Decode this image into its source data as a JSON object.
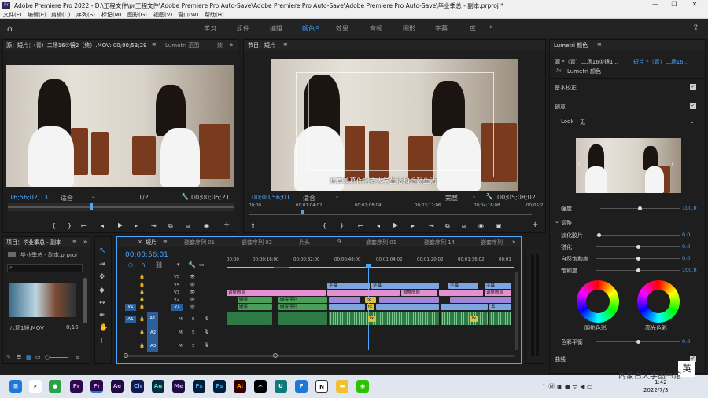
{
  "window": {
    "title": "Adobe Premiere Pro 2022 - D:\\工程文件\\pr工程文件\\Adobe Premiere Pro Auto-Save\\Adobe Premiere Pro Auto-Save\\Adobe Premiere Pro Auto-Save\\毕业季总 - 副本.prproj *",
    "minimize": "—",
    "maximize": "❐",
    "close": "✕"
  },
  "menu": [
    "文件(F)",
    "编辑(E)",
    "剪辑(C)",
    "序列(S)",
    "标记(M)",
    "图形(G)",
    "视图(V)",
    "窗口(W)",
    "帮助(H)"
  ],
  "workspaces": [
    "学习",
    "组件",
    "编辑",
    "颜色",
    "效果",
    "音频",
    "图形",
    "字幕",
    "库"
  ],
  "workspace_active": "颜色",
  "source": {
    "tab": "源：短片：(青）二场16②镜2（终）.MOV: 00;00;53;29",
    "tab2": "Lumetri 范围",
    "tab3": "效",
    "timecode": "16;56;02;13",
    "fit": "适合",
    "ratio": "1/2",
    "duration": "00;00;05;21"
  },
  "program": {
    "tab": "节目：短片",
    "timecode": "00;00;56;01",
    "fit": "适合",
    "quality": "完整",
    "duration": "00;05;08;02",
    "ruler": [
      "00;00",
      "00;01;04;02",
      "00;02;08;04",
      "00;03;12;06",
      "00;04;16;08",
      "00;05;2"
    ],
    "subtitle": "我真羡慕你啊去大学生活和后勤生活"
  },
  "project": {
    "tab": "项目：毕业季总 - 副本",
    "file": "毕业季总 - 副本.prproj",
    "item_name": "八场1镜.MOV",
    "item_duration": "8;16"
  },
  "timeline": {
    "tabs": [
      "短片",
      "嵌套序列 01",
      "嵌套序列 02",
      "片头",
      "9",
      "嵌套序列 01",
      "嵌套序列 14",
      "嵌套序列"
    ],
    "timecode": "00;00;56;01",
    "ruler": [
      "00;00",
      "00;00;16;00",
      "00;00;32;00",
      "00;00;48;00",
      "00;01;04;02",
      "00;01;20;02",
      "00;01;36;02",
      "00;01"
    ],
    "video_tracks": [
      "V5",
      "V4",
      "V3",
      "V2",
      "V1"
    ],
    "audio_tracks": [
      "A1",
      "A2",
      "A3"
    ],
    "src_v": "V1",
    "src_a": "A1",
    "clip_labels": {
      "subtitle": "字幕",
      "adjust": "调整图层",
      "nest": "嵌套",
      "nest_seq": "嵌套序列",
      "fx": "fx",
      "wu": "五"
    },
    "mute": "M",
    "solo": "S"
  },
  "lumetri": {
    "title": "Lumetri 颜色",
    "source": "源 *（青）二场16①镜1...",
    "target": "短片 *（青）二场16...",
    "fx_label": "Lumetri 颜色",
    "basic": "基本校正",
    "creative": "创意",
    "look_label": "Look",
    "look_value": "无",
    "intensity": {
      "label": "强度",
      "value": "100.0"
    },
    "adjust": "调整",
    "sliders": [
      {
        "label": "淡化胶片",
        "value": "0.0"
      },
      {
        "label": "锐化",
        "value": "0.0"
      },
      {
        "label": "自然饱和度",
        "value": "0.0"
      },
      {
        "label": "饱和度",
        "value": "100.0"
      }
    ],
    "shadow_tint": "阴影色彩",
    "highlight_tint": "高光色彩",
    "tint_balance": {
      "label": "色彩平衡",
      "value": "0.0"
    },
    "curves": "曲线"
  },
  "taskbar": {
    "icons": [
      "Pr",
      "Pr",
      "Ae",
      "Ch",
      "Au",
      "Me",
      "Ps",
      "Ps",
      "Ai",
      "U",
      "F",
      "N"
    ],
    "clock_time": "1:42",
    "clock_date": "2022/7/3",
    "ime": "英",
    "watermark": "内蒙古大学图书馆"
  }
}
